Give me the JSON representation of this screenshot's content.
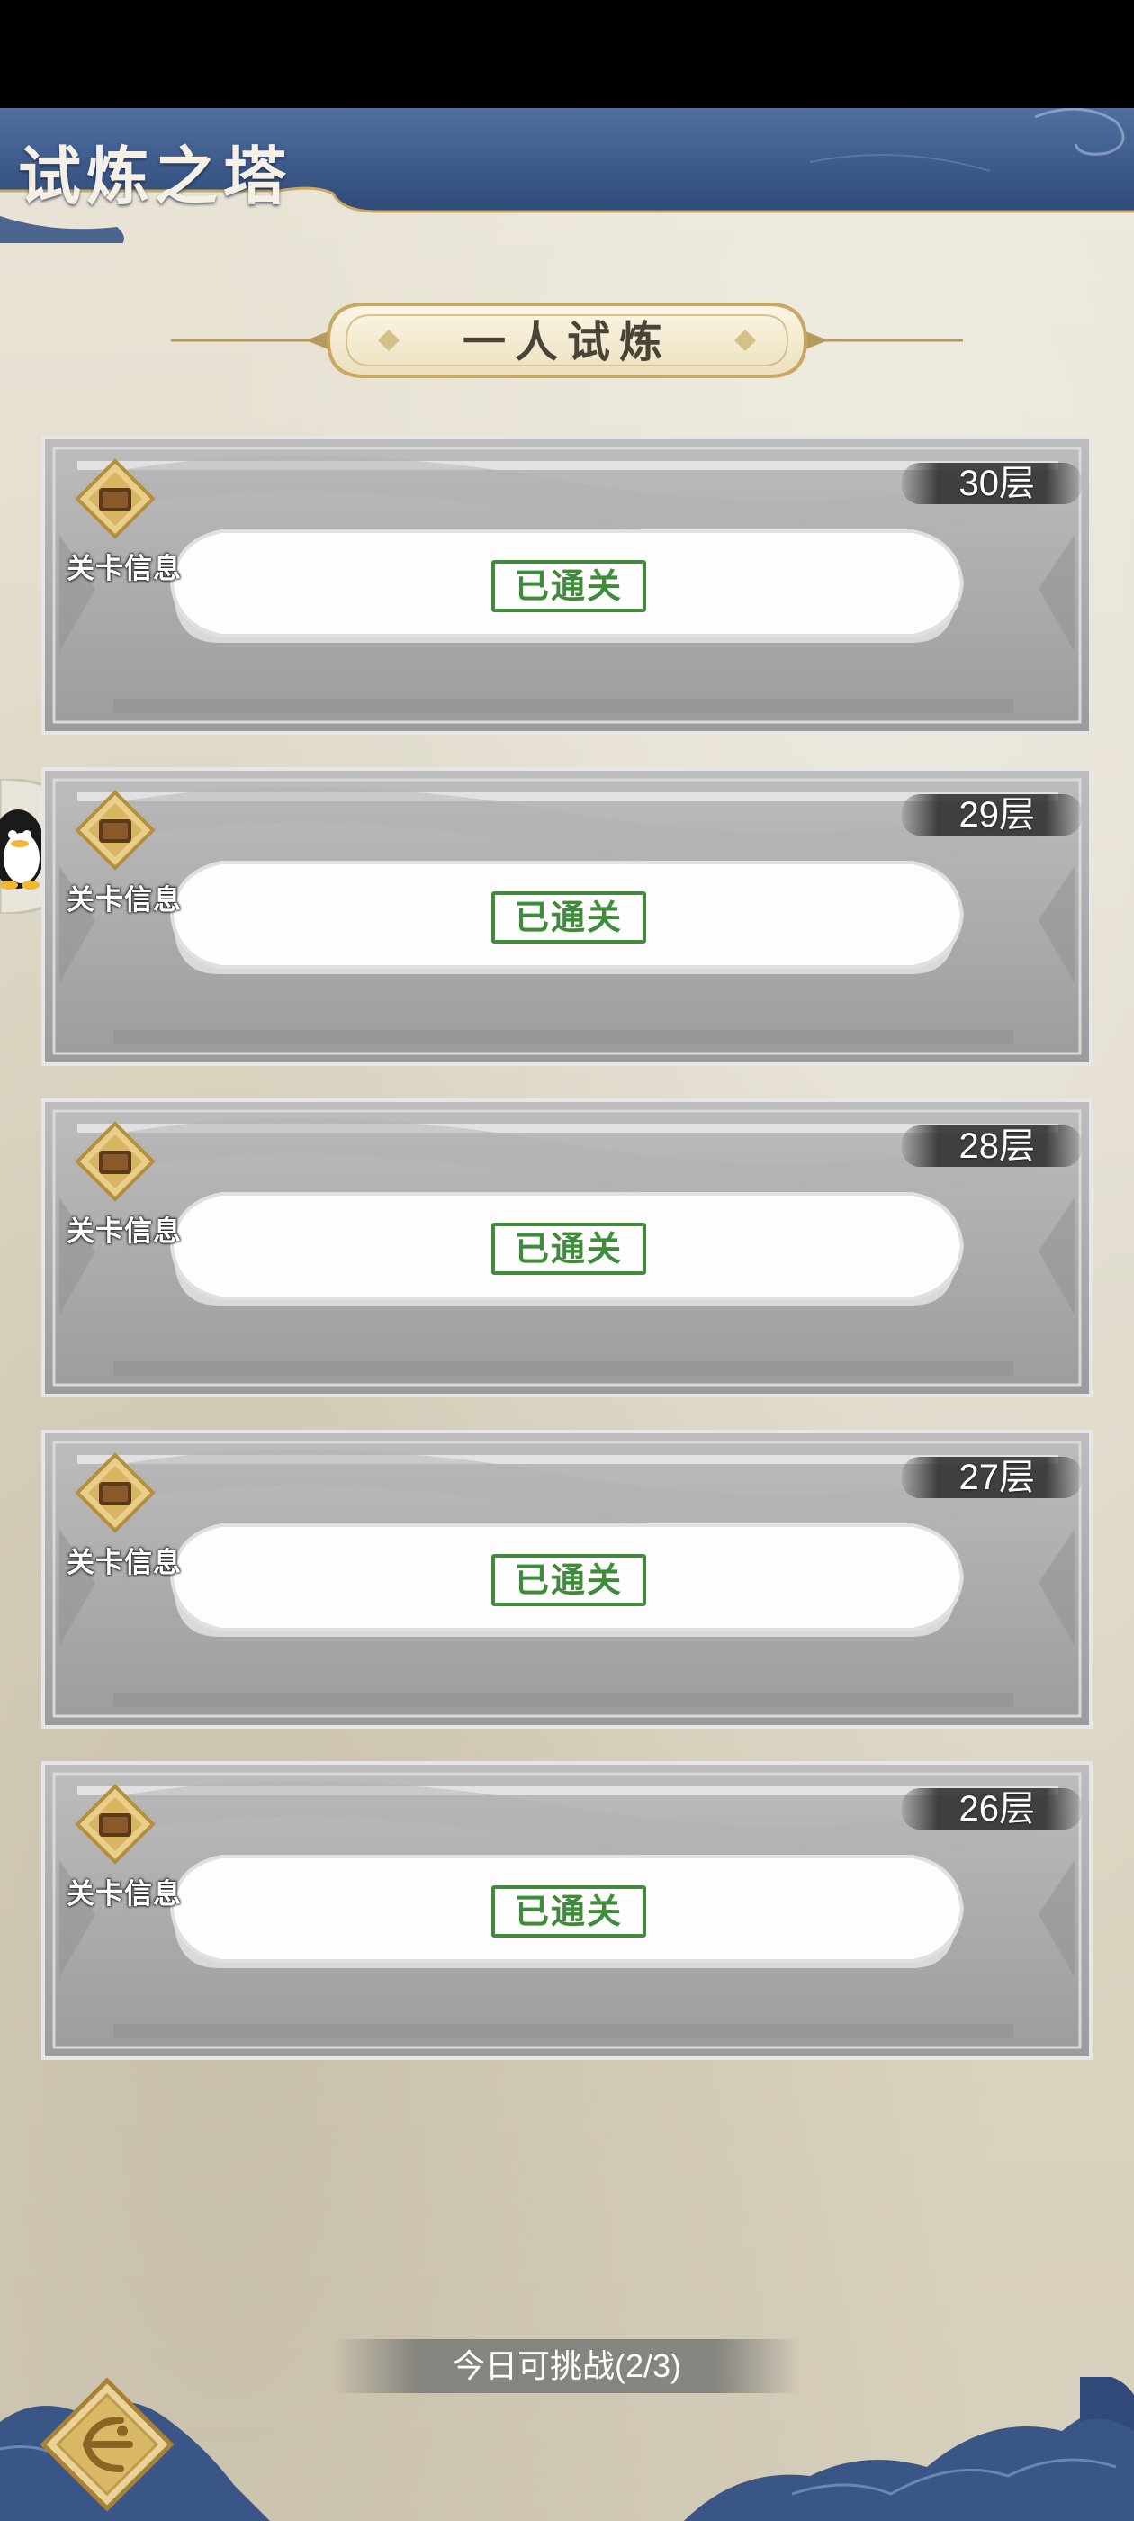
{
  "header": {
    "title": "试炼之塔"
  },
  "mode": {
    "title": "一人试炼"
  },
  "floors": [
    {
      "label": "30层",
      "info_label": "关卡信息",
      "status": "已通关"
    },
    {
      "label": "29层",
      "info_label": "关卡信息",
      "status": "已通关"
    },
    {
      "label": "28层",
      "info_label": "关卡信息",
      "status": "已通关"
    },
    {
      "label": "27层",
      "info_label": "关卡信息",
      "status": "已通关"
    },
    {
      "label": "26层",
      "info_label": "关卡信息",
      "status": "已通关"
    }
  ],
  "footer": {
    "challenge_text": "今日可挑战(2/3)"
  },
  "icons": {
    "stage_info": "scroll-icon",
    "back": "back-arrow-icon",
    "side": "penguin-icon"
  },
  "colors": {
    "banner_blue": "#3d5a8a",
    "gold": "#c9a862",
    "cleared_green": "#3e8b3a",
    "paper": "#e6e0d0"
  }
}
